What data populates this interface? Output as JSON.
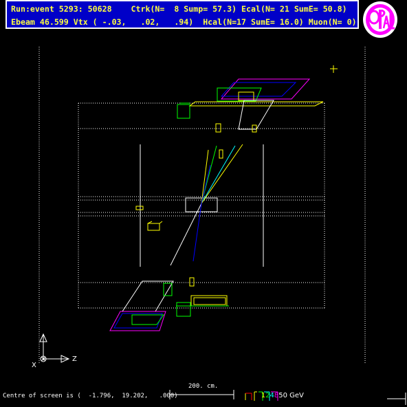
{
  "header": {
    "line1": "Run:event 5293: 50628    Ctrk(N=  8 Sump= 57.3) Ecal(N= 21 SumE= 50.8)",
    "line2": "Ebeam 46.599 Vtx ( -.03,   .02,   .94)  Hcal(N=17 SumE= 16.0) Muon(N= 0)"
  },
  "logo": {
    "text": "OPAL",
    "ring_color": "#ff00ff"
  },
  "axes": {
    "x_label": "X",
    "z_label": "Z"
  },
  "scale": {
    "label": "200. cm."
  },
  "energy_legend": {
    "items": [
      {
        "text": "1",
        "color": "#ffff00"
      },
      {
        "text": "2",
        "color": "#00ff00"
      },
      {
        "text": "4",
        "color": "#00ffff"
      },
      {
        "text": "8",
        "color": "#ff00ff"
      },
      {
        "text": "50 GeV",
        "color": "#ffffff"
      }
    ]
  },
  "status": {
    "text": "Centre of screen is (  -1.796,  19.202,   .000)"
  },
  "colors": {
    "background": "#000000",
    "header_bg": "#0000c8",
    "header_text": "#ffff40"
  }
}
